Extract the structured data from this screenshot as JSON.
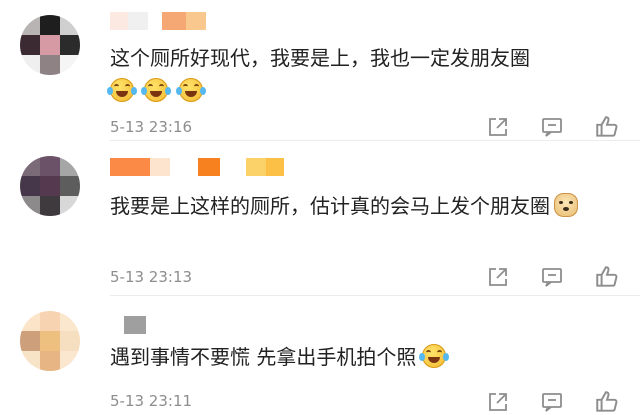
{
  "comments": [
    {
      "text": "这个厕所好现代，我要是上，我也一定发朋友圈",
      "time": "5-13 23:16",
      "emojis": [
        "laugh-cry-emoji",
        "laugh-cry-emoji",
        "laugh-cry-emoji"
      ],
      "avatar_colors": [
        "#b9b4b4",
        "#1e1e1e",
        "#cfcfcf",
        "#3c2a33",
        "#d59aa4",
        "#2b2b2b",
        "#efefef",
        "#8e8284",
        "#f5f5f5"
      ],
      "username_colors": [
        "#fbe9e2",
        "#f0f0f0",
        "#ffffff",
        "#f6a874",
        "#f8c88e"
      ]
    },
    {
      "text": "我要是上这样的厕所，估计真的会马上发个朋友圈",
      "time": "5-13 23:13",
      "emojis": [
        "doge-emoji"
      ],
      "avatar_colors": [
        "#7b6a78",
        "#6c5268",
        "#a7a6a6",
        "#46384a",
        "#55394f",
        "#5e5d5e",
        "#8d8a8c",
        "#3f3a3e",
        "#d8d8d8"
      ],
      "username_colors": [
        "#fa8a45",
        "#fde4cf",
        "#ffffff",
        "#f7811f",
        "#ffffff",
        "#fbd26a",
        "#fcc046"
      ]
    },
    {
      "text": "遇到事情不要慌 先拿出手机拍个照",
      "time": "5-13 23:11",
      "emojis": [
        "laugh-cry-emoji"
      ],
      "avatar_colors": [
        "#fbe4c8",
        "#f7d3b1",
        "#fbe6ce",
        "#cd9f7b",
        "#edc07f",
        "#f6dfc1",
        "#f7e3c6",
        "#e6b583",
        "#fbe7cf"
      ],
      "username_colors": [
        "#ffffff",
        "#9f9f9f"
      ]
    }
  ],
  "icons": {
    "share": "share-icon",
    "reply": "comment-icon",
    "like": "thumbs-up-icon"
  },
  "colors": {
    "text": "#222222",
    "time": "#8d8d8d",
    "icon": "#8d8d8d"
  }
}
